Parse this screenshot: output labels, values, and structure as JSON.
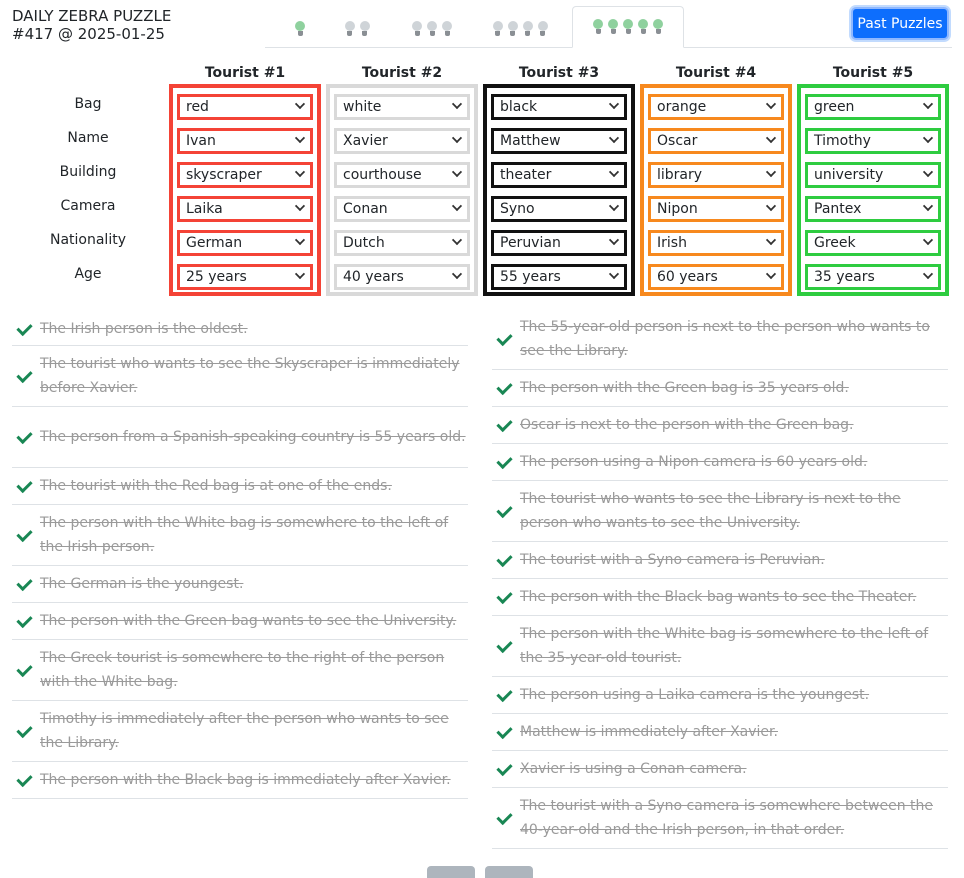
{
  "header": {
    "title_line1": "DAILY ZEBRA PUZZLE",
    "title_line2": "#417 @ 2025-01-25",
    "past_button": "Past Puzzles",
    "difficulty_tabs": [
      {
        "icons": "lightbulb-icon",
        "count": 1
      },
      {
        "icons": "lightbulb-icon",
        "count": 2
      },
      {
        "icons": "lightbulb-icon",
        "count": 3
      },
      {
        "icons": "lightbulb-icon",
        "count": 4
      },
      {
        "icons": "lightbulb-icon",
        "count": 5,
        "active": true
      }
    ]
  },
  "grid": {
    "attributes": [
      "Bag",
      "Name",
      "Building",
      "Camera",
      "Nationality",
      "Age"
    ],
    "tourists": [
      {
        "header": "Tourist #1",
        "color": "#f44336",
        "values": [
          "red",
          "Ivan",
          "skyscraper",
          "Laika",
          "German",
          "25 years"
        ]
      },
      {
        "header": "Tourist #2",
        "color": "#d9d9d9",
        "values": [
          "white",
          "Xavier",
          "courthouse",
          "Conan",
          "Dutch",
          "40 years"
        ]
      },
      {
        "header": "Tourist #3",
        "color": "#111111",
        "values": [
          "black",
          "Matthew",
          "theater",
          "Syno",
          "Peruvian",
          "55 years"
        ]
      },
      {
        "header": "Tourist #4",
        "color": "#f7891e",
        "values": [
          "orange",
          "Oscar",
          "library",
          "Nipon",
          "Irish",
          "60 years"
        ]
      },
      {
        "header": "Tourist #5",
        "color": "#2ecc40",
        "values": [
          "green",
          "Timothy",
          "university",
          "Pantex",
          "Greek",
          "35 years"
        ]
      }
    ]
  },
  "clues": {
    "left": [
      "The Irish person is the oldest.",
      "The tourist who wants to see the Skyscraper is immediately before Xavier.",
      "The person from a Spanish-speaking country is 55 years old.",
      "The tourist with the Red bag is at one of the ends.",
      "The person with the White bag is somewhere to the left of the Irish person.",
      "The German is the youngest.",
      "The person with the Green bag wants to see the University.",
      "The Greek tourist is somewhere to the right of the person with the White bag.",
      "Timothy is immediately after the person who wants to see the Library.",
      "The person with the Black bag is immediately after Xavier."
    ],
    "right": [
      "The 55-year-old person is next to the person who wants to see the Library.",
      "The person with the Green bag is 35 years old.",
      "Oscar is next to the person with the Green bag.",
      "The person using a Nipon camera is 60 years old.",
      "The tourist who wants to see the Library is next to the person who wants to see the University.",
      "The tourist with a Syno camera is Peruvian.",
      "The person with the Black bag wants to see the Theater.",
      "The person with the White bag is somewhere to the left of the 35-year-old tourist.",
      "The person using a Laika camera is the youngest.",
      "Matthew is immediately after Xavier.",
      "Xavier is using a Conan camera.",
      "The tourist with a Syno camera is somewhere between the 40-year-old and the Irish person, in that order."
    ]
  }
}
